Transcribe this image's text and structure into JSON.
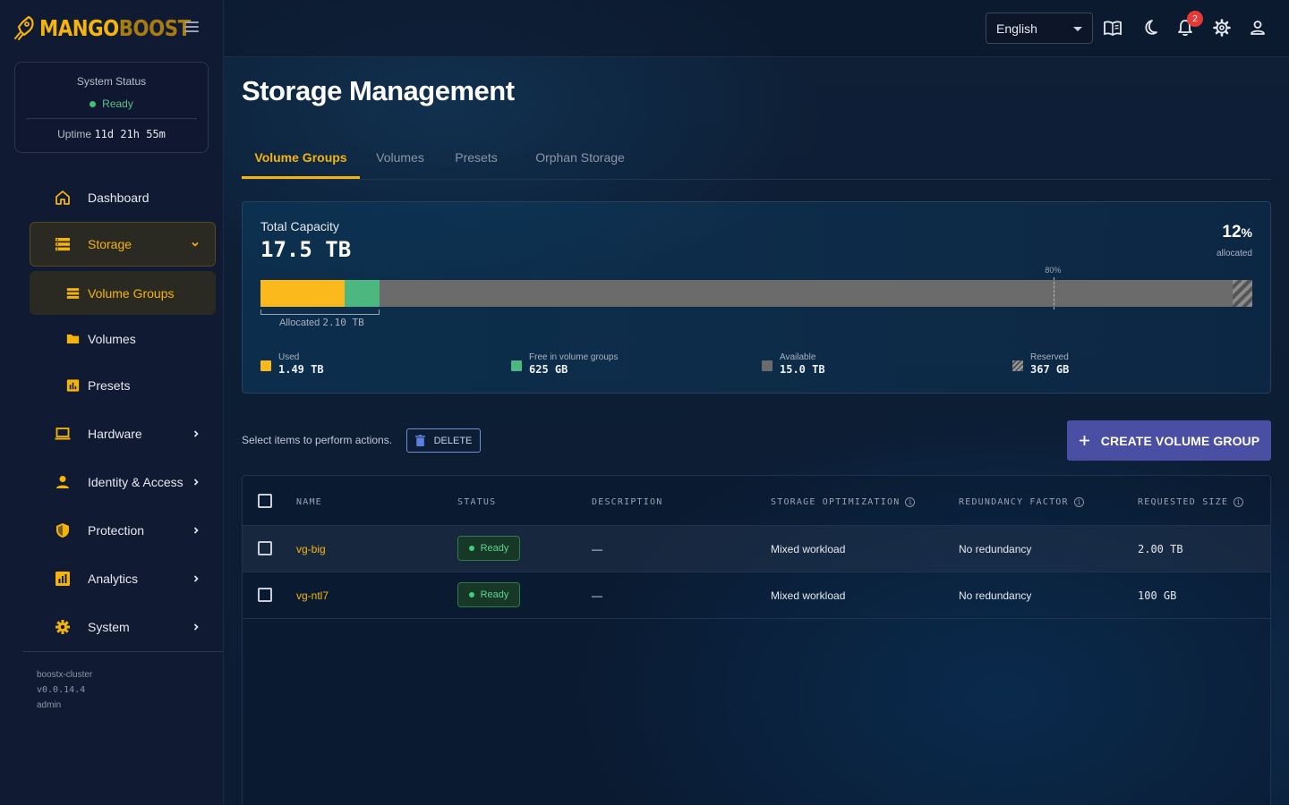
{
  "brand": {
    "part1": "MANGO",
    "part2": "BOOST"
  },
  "colors": {
    "accent": "#f5b40c",
    "used": "#fbb91c",
    "free": "#4cb77f",
    "available": "#6b6b6b",
    "primary_button": "#4a4fa3",
    "status_ready": "#3fbf74"
  },
  "system_status": {
    "title": "System Status",
    "state": "Ready",
    "uptime_label": "Uptime",
    "uptime_value": "11d 21h 55m"
  },
  "nav": {
    "dashboard": "Dashboard",
    "storage": "Storage",
    "volume_groups": "Volume Groups",
    "volumes": "Volumes",
    "presets": "Presets",
    "hardware": "Hardware",
    "identity": "Identity & Access",
    "protection": "Protection",
    "analytics": "Analytics",
    "system": "System"
  },
  "footer": {
    "cluster": "boostx-cluster",
    "version": "v0.0.14.4",
    "user": "admin"
  },
  "topbar": {
    "language": "English",
    "notifications_count": "2",
    "icons": [
      "book-icon",
      "moon-icon",
      "bell-icon",
      "gear-icon",
      "user-icon"
    ]
  },
  "page": {
    "title": "Storage Management"
  },
  "tabs": [
    "Volume Groups",
    "Volumes",
    "Presets",
    "Orphan Storage"
  ],
  "capacity": {
    "label": "Total Capacity",
    "total": "17.5 TB",
    "percent": "12",
    "percent_sign": "%",
    "percent_label": "allocated",
    "marker_label": "80%",
    "marker_value": 0.8,
    "allocated_label": "Allocated",
    "allocated_value": "2.10 TB",
    "bar_fractions": {
      "used": 0.085,
      "free": 0.035,
      "reserved": 0.02
    },
    "legend": [
      {
        "name": "Used",
        "value": "1.49 TB"
      },
      {
        "name": "Free in volume groups",
        "value": "625 GB"
      },
      {
        "name": "Available",
        "value": "15.0 TB"
      },
      {
        "name": "Reserved",
        "value": "367 GB"
      }
    ]
  },
  "actions": {
    "hint": "Select items to perform actions.",
    "delete": "DELETE",
    "create": "CREATE VOLUME GROUP"
  },
  "table": {
    "columns": [
      "NAME",
      "STATUS",
      "DESCRIPTION",
      "STORAGE OPTIMIZATION",
      "REDUNDANCY FACTOR",
      "REQUESTED SIZE"
    ],
    "rows": [
      {
        "name": "vg-big",
        "status": "Ready",
        "description": "—",
        "optimization": "Mixed workload",
        "redundancy": "No redundancy",
        "size": "2.00 TB"
      },
      {
        "name": "vg-ntl7",
        "status": "Ready",
        "description": "—",
        "optimization": "Mixed workload",
        "redundancy": "No redundancy",
        "size": "100 GB"
      }
    ]
  }
}
